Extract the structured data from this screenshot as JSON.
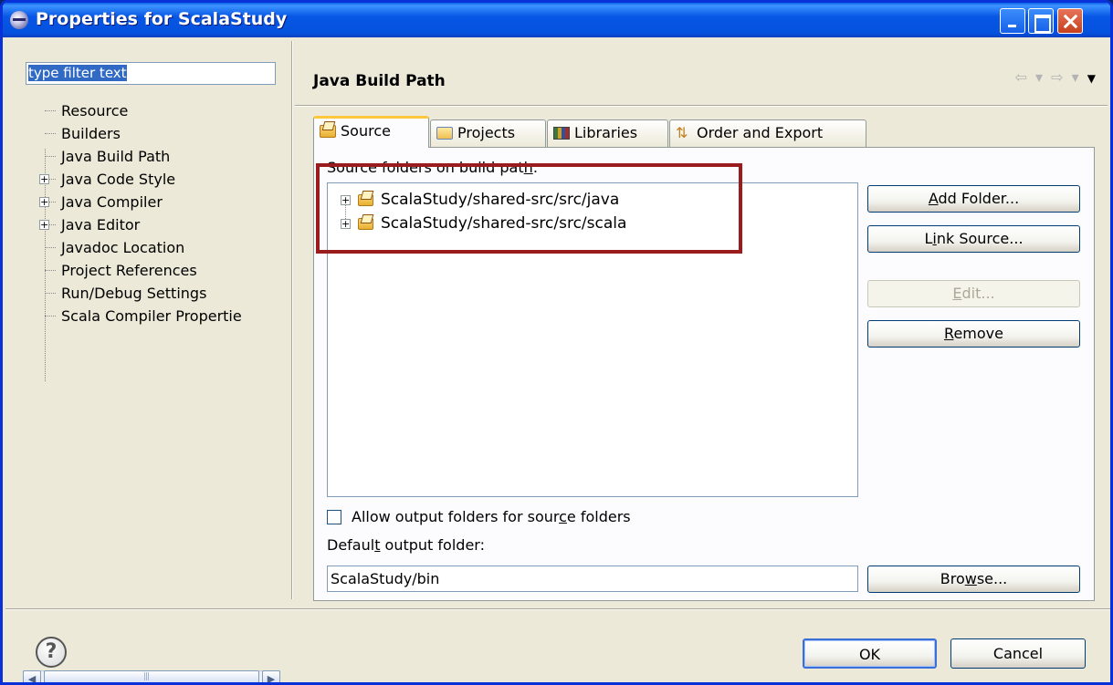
{
  "window": {
    "title": "Properties for ScalaStudy"
  },
  "filter": {
    "value": "type filter text"
  },
  "tree": {
    "items": [
      {
        "label": "Resource",
        "expandable": false
      },
      {
        "label": "Builders",
        "expandable": false
      },
      {
        "label": "Java Build Path",
        "expandable": false,
        "selected": true
      },
      {
        "label": "Java Code Style",
        "expandable": true
      },
      {
        "label": "Java Compiler",
        "expandable": true
      },
      {
        "label": "Java Editor",
        "expandable": true
      },
      {
        "label": "Javadoc Location",
        "expandable": false
      },
      {
        "label": "Project References",
        "expandable": false
      },
      {
        "label": "Run/Debug Settings",
        "expandable": false
      },
      {
        "label": "Scala Compiler Propertie",
        "expandable": false
      }
    ]
  },
  "page": {
    "title": "Java Build Path",
    "nav": {
      "back": "⇦",
      "forward": "⇨",
      "menu": "▼"
    }
  },
  "tabs": [
    {
      "label": "Source",
      "icon": "source-folder-icon",
      "active": true
    },
    {
      "label": "Projects",
      "icon": "project-folder-icon",
      "active": false
    },
    {
      "label": "Libraries",
      "icon": "libraries-icon",
      "active": false
    },
    {
      "label": "Order and Export",
      "icon": "order-export-icon",
      "active": false
    }
  ],
  "source": {
    "section_label_pre": "Source folders on build pat",
    "section_label_mnemonic": "h",
    "section_label_post": ":",
    "folders": [
      "ScalaStudy/shared-src/src/java",
      "ScalaStudy/shared-src/src/scala"
    ],
    "buttons": {
      "add_folder": {
        "mnemonic": "A",
        "rest": "dd Folder..."
      },
      "link_source": {
        "pre": "L",
        "mnemonic": "i",
        "rest": "nk Source..."
      },
      "edit": {
        "mnemonic": "E",
        "rest": "dit..."
      },
      "remove": {
        "mnemonic": "R",
        "rest": "emove"
      },
      "browse": {
        "pre": "Bro",
        "mnemonic": "w",
        "rest": "se..."
      }
    },
    "allow_output": {
      "pre": "Allow output folders for sour",
      "mnemonic": "c",
      "post": "e folders",
      "checked": false
    },
    "output_label": {
      "pre": "Defaul",
      "mnemonic": "t",
      "post": " output folder:"
    },
    "output_value": "ScalaStudy/bin"
  },
  "footer": {
    "help": "?",
    "ok": "OK",
    "cancel": "Cancel"
  },
  "colors": {
    "titlebar": "#0451dd",
    "highlight_box": "#9b1c1c",
    "dialog_bg": "#ece9d8"
  }
}
